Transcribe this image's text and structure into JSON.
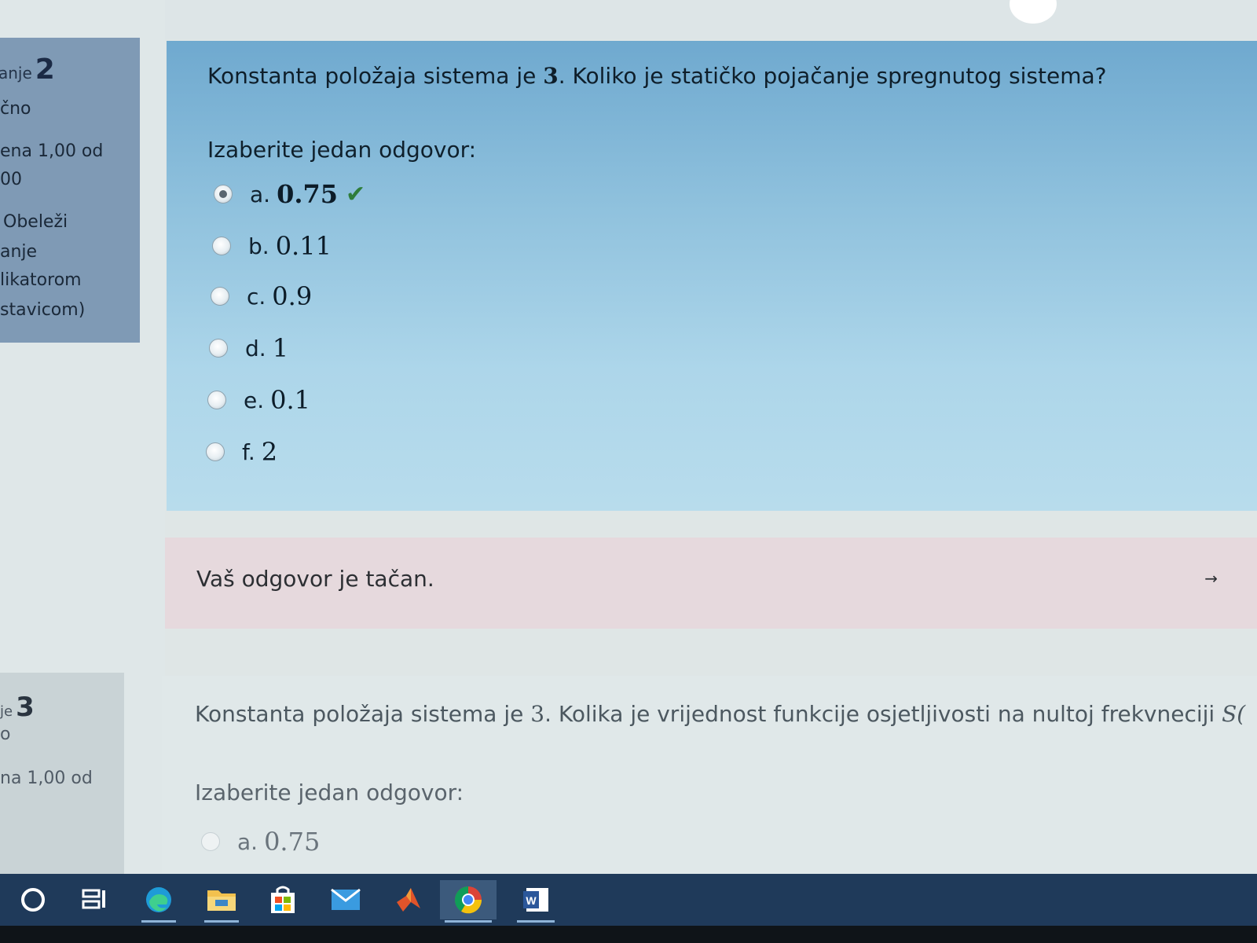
{
  "question2": {
    "sidebar": {
      "label": "anje",
      "number": "2",
      "status": "čno",
      "grade_line1": "ena 1,00 od",
      "grade_line2": "00",
      "flag_line1": "Obeleži",
      "flag_line2": "anje",
      "flag_line3": "likatorom",
      "flag_line4": "stavicom)"
    },
    "text_before": "Konstanta položaja sistema je ",
    "text_value": "3",
    "text_after": ". Koliko je statičko pojačanje spregnutog sistema?",
    "prompt": "Izaberite jedan odgovor:",
    "answers": [
      {
        "letter": "a.",
        "value": "0.75",
        "checked": true,
        "correct_mark": "✔"
      },
      {
        "letter": "b.",
        "value": "0.11",
        "checked": false
      },
      {
        "letter": "c.",
        "value": "0.9",
        "checked": false
      },
      {
        "letter": "d.",
        "value": "1",
        "checked": false
      },
      {
        "letter": "e.",
        "value": "0.1",
        "checked": false
      },
      {
        "letter": "f.",
        "value": "2",
        "checked": false
      }
    ],
    "feedback": "Vaš odgovor je tačan.",
    "feedback_arrow": "→"
  },
  "question3": {
    "sidebar": {
      "label": "je",
      "number": "3",
      "status": "o",
      "grade_line1": "na 1,00 od"
    },
    "text_before": "Konstanta položaja sistema je ",
    "text_value": "3",
    "text_after": ". Kolika je vrijednost funkcije osjetljivosti na nultoj frekvneciji ",
    "text_math": "S(",
    "prompt": "Izaberite jedan odgovor:",
    "answers": [
      {
        "letter": "a.",
        "value": "0.75"
      }
    ]
  },
  "taskbar": {
    "icons": [
      "cortana-icon",
      "task-view-icon",
      "edge-icon",
      "file-explorer-icon",
      "store-icon",
      "mail-icon",
      "matlab-icon",
      "chrome-icon",
      "word-icon"
    ]
  }
}
